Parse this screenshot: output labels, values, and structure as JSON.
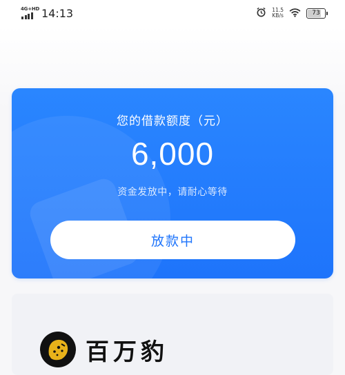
{
  "status_bar": {
    "network": "4G+HD",
    "time": "14:13",
    "speed_value": "11.5",
    "speed_unit": "KB/s",
    "battery": "73"
  },
  "loan_card": {
    "title": "您的借款额度（元）",
    "amount": "6,000",
    "status_text": "资金发放中，请耐心等待",
    "button_label": "放款中"
  },
  "watermark": {
    "text": "百万豹",
    "logo_icon": "leopard-logo-icon"
  },
  "colors": {
    "card_blue": "#1e74fb",
    "background": "#f7f7f9"
  }
}
